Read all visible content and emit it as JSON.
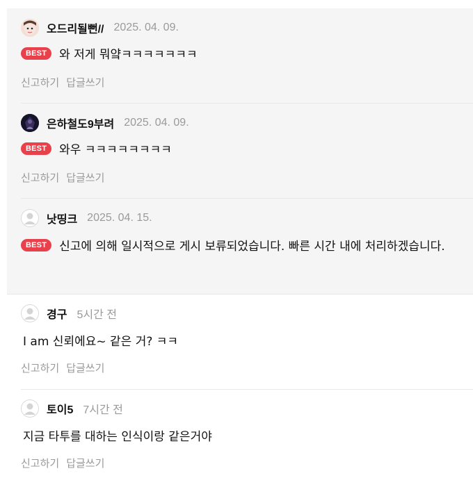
{
  "best_label": "BEST",
  "actions": {
    "report": "신고하기",
    "reply": "답글쓰기"
  },
  "comments": [
    {
      "nickname": "오드리될뻔//",
      "date": "2025. 04. 09.",
      "text": "와 저게 뭐얔ㅋㅋㅋㅋㅋㅋㅋ",
      "best": true
    },
    {
      "nickname": "은하철도9부려",
      "date": "2025. 04. 09.",
      "text": "와우 ㅋㅋㅋㅋㅋㅋㅋㅋ",
      "best": true
    },
    {
      "nickname": "낫띵크",
      "date": "2025. 04. 15.",
      "text": "신고에 의해 일시적으로 게시 보류되었습니다. 빠른 시간 내에 처리하겠습니다.",
      "best": true
    },
    {
      "nickname": "경구",
      "date": "5시간 전",
      "text": "I am 신뢰에요~ 같은 거? ㅋㅋ",
      "best": false
    },
    {
      "nickname": "토이5",
      "date": "7시간 전",
      "text": "지금 타투를 대하는 인식이랑 같은거야",
      "best": false
    }
  ]
}
